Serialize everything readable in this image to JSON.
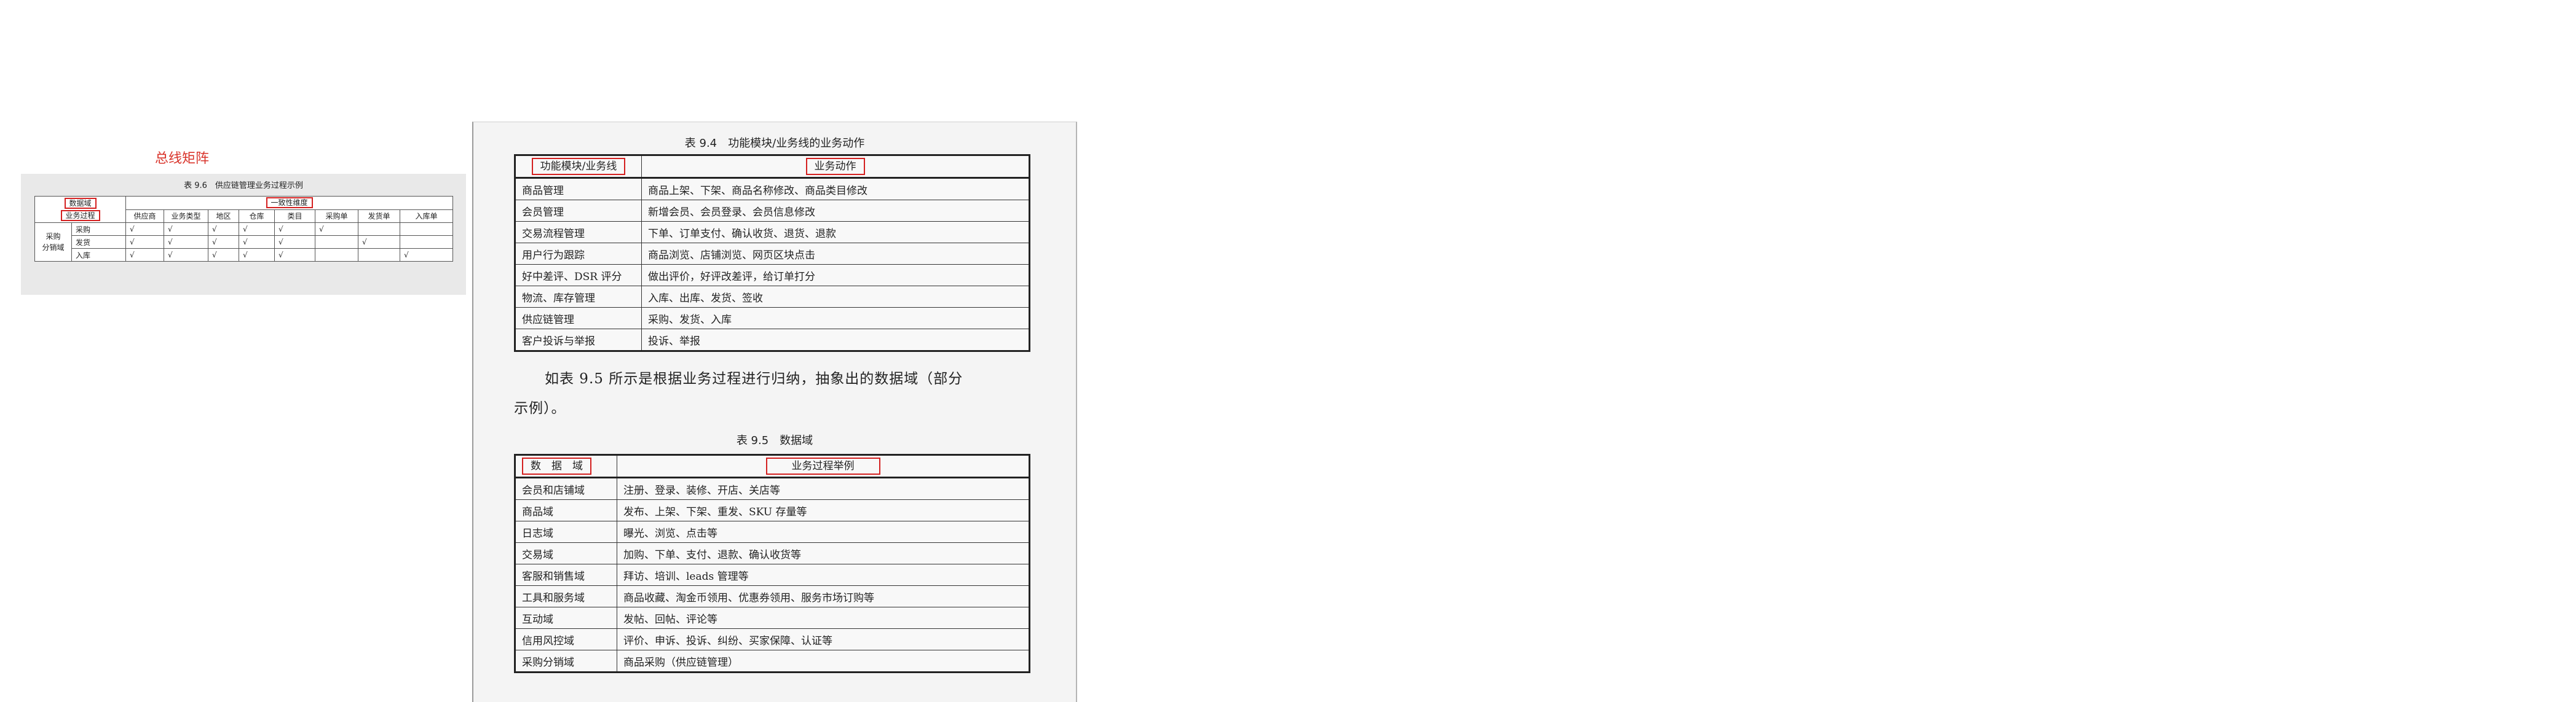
{
  "bus_matrix": {
    "label": "总线矩阵",
    "caption": "表 9.6　供应链管理业务过程示例",
    "corner_top": "数据域",
    "corner_bottom": "业务过程",
    "dimension_group": "一致性维度",
    "columns": [
      "供应商",
      "业务类型",
      "地区",
      "仓库",
      "类目",
      "采购单",
      "发货单",
      "入库单"
    ],
    "domain_line1": "采购",
    "domain_line2": "分销域",
    "rows": [
      {
        "process": "采购",
        "cells": [
          "√",
          "√",
          "√",
          "√",
          "√",
          "√",
          "",
          ""
        ]
      },
      {
        "process": "发货",
        "cells": [
          "√",
          "√",
          "√",
          "√",
          "√",
          "",
          "√",
          ""
        ]
      },
      {
        "process": "入库",
        "cells": [
          "√",
          "√",
          "√",
          "√",
          "√",
          "",
          "",
          "√"
        ]
      }
    ]
  },
  "table94": {
    "caption": "表 9.4　功能模块/业务线的业务动作",
    "header": [
      "功能模块/业务线",
      "业务动作"
    ],
    "rows": [
      [
        "商品管理",
        "商品上架、下架、商品名称修改、商品类目修改"
      ],
      [
        "会员管理",
        "新增会员、会员登录、会员信息修改"
      ],
      [
        "交易流程管理",
        "下单、订单支付、确认收货、退货、退款"
      ],
      [
        "用户行为跟踪",
        "商品浏览、店铺浏览、网页区块点击"
      ],
      [
        "好中差评、DSR 评分",
        "做出评价，好评改差评，给订单打分"
      ],
      [
        "物流、库存管理",
        "入库、出库、发货、签收"
      ],
      [
        "供应链管理",
        "采购、发货、入库"
      ],
      [
        "客户投诉与举报",
        "投诉、举报"
      ]
    ]
  },
  "paragraph": {
    "line1": "如表 9.5 所示是根据业务过程进行归纳，抽象出的数据域（部分",
    "line2": "示例）。"
  },
  "table95": {
    "caption": "表 9.5　数据域",
    "header": [
      "数　据　域",
      "业务过程举例"
    ],
    "rows": [
      [
        "会员和店铺域",
        "注册、登录、装修、开店、关店等"
      ],
      [
        "商品域",
        "发布、上架、下架、重发、SKU 存量等"
      ],
      [
        "日志域",
        "曝光、浏览、点击等"
      ],
      [
        "交易域",
        "加购、下单、支付、退款、确认收货等"
      ],
      [
        "客服和销售域",
        "拜访、培训、leads 管理等"
      ],
      [
        "工具和服务域",
        "商品收藏、淘金币领用、优惠券领用、服务市场订购等"
      ],
      [
        "互动域",
        "发帖、回帖、评论等"
      ],
      [
        "信用风控域",
        "评价、申诉、投诉、纠纷、买家保障、认证等"
      ],
      [
        "采购分销域",
        "商品采购（供应链管理）"
      ]
    ]
  },
  "colors": {
    "highlight": "#d42020",
    "label": "#d9342b"
  }
}
